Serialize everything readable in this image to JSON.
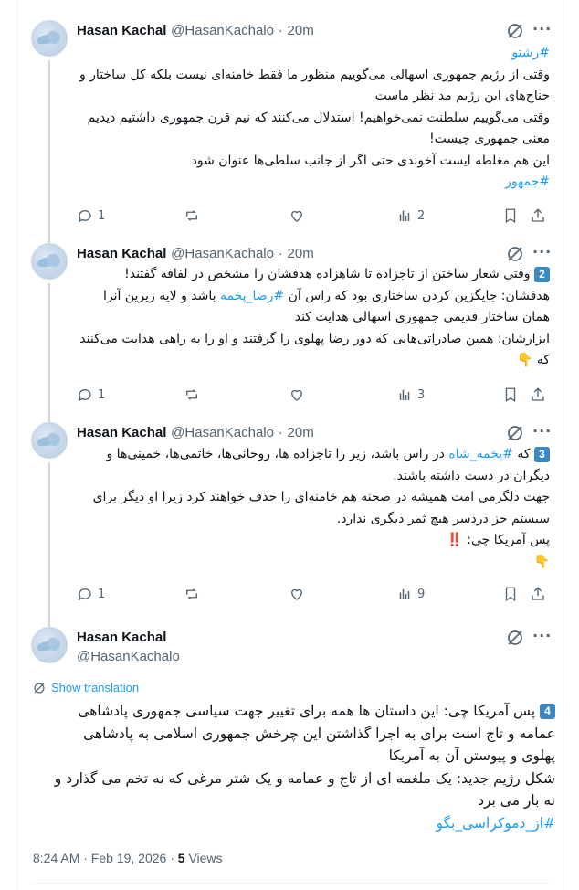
{
  "tweets": [
    {
      "name": "Hasan Kachal",
      "handle": "@HasanKachalo",
      "time": "20m",
      "lines": [
        [
          {
            "t": "#رشتو",
            "tag": true
          }
        ],
        [
          {
            "t": "وقتی از رژیم جمهوری اسهالی می‌گوییم منظور ما فقط خامنه‌ای نیست بلکه کل ساختار و"
          }
        ],
        [
          {
            "t": "جناح‌های این رژیم مد نظر ماست"
          }
        ],
        [
          {
            "t": "وقتی می‌گوییم سلطنت نمی‌خواهیم! استدلال می‌کنند که نیم قرن جمهوری داشتیم دیدیم"
          }
        ],
        [
          {
            "t": "معنی جمهوری چیست!"
          }
        ],
        [
          {
            "t": "این هم مغلطه ایست آخوندی حتی اگر از جانب سلطی‌ها عنوان شود"
          }
        ],
        [
          {
            "t": "#جمهور",
            "tag": true
          }
        ]
      ],
      "replies": "1",
      "reposts": "",
      "likes": "",
      "views": "2"
    },
    {
      "name": "Hasan Kachal",
      "handle": "@HasanKachalo",
      "time": "20m",
      "lines": [
        [
          {
            "t": "2",
            "num": true
          },
          {
            "t": " وقتی شعار ساختن از تاجزاده تا شاهزاده هدفشان را مشخص در لفافه گفتند!"
          }
        ],
        [
          {
            "t": "هدفشان: جایگزین کردن ساختاری بود که راس آن "
          },
          {
            "t": "#رضا_پخمه",
            "tag": true
          },
          {
            "t": " باشد و لایه زیرین آنرا"
          }
        ],
        [
          {
            "t": "همان ساختار قدیمی جمهوری اسهالی هدایت کند"
          }
        ],
        [
          {
            "t": "ابزارشان: همین صادراتی‌هایی که دور رضا پهلوی را گرفتند و او را به راهی هدایت می‌کنند"
          }
        ],
        [
          {
            "t": "که "
          },
          {
            "t": "👇",
            "hand": true
          }
        ]
      ],
      "replies": "1",
      "reposts": "",
      "likes": "",
      "views": "3"
    },
    {
      "name": "Hasan Kachal",
      "handle": "@HasanKachalo",
      "time": "20m",
      "lines": [
        [
          {
            "t": "3",
            "num": true
          },
          {
            "t": " که "
          },
          {
            "t": "#پخمه_شاه",
            "tag": true
          },
          {
            "t": " در راس باشد، زیر را تاجزاده ها، روحانی‌ها، خاتمی‌ها، خمینی‌ها و"
          }
        ],
        [
          {
            "t": "دیگران در دست داشته باشند."
          }
        ],
        [
          {
            "t": "جهت دلگرمی امت همیشه در صحنه هم خامنه‌ای را حذف خواهند کرد زیرا او دیگر برای"
          }
        ],
        [
          {
            "t": "سیستم جز دردسر هیچ ثمر دیگری ندارد."
          }
        ],
        [
          {
            "t": "پس آمریکا چی: "
          },
          {
            "t": "‼️",
            "bang": true
          }
        ],
        [
          {
            "t": "👇",
            "hand": true
          }
        ]
      ],
      "replies": "1",
      "reposts": "",
      "likes": "",
      "views": "9"
    }
  ],
  "main": {
    "name": "Hasan Kachal",
    "handle": "@HasanKachalo",
    "show_translation": "Show translation",
    "lines": [
      [
        {
          "t": "4",
          "num": true
        },
        {
          "t": " پس آمریکا چی: این داستان ها همه برای تغییر جهت سیاسی جمهوری پادشاهی"
        }
      ],
      [
        {
          "t": "عمامه و تاج است برای به اجرا گذاشتن این چرخش جمهوری اسلامی به پادشاهی"
        }
      ],
      [
        {
          "t": "پهلوی و پیوستن آن به آمریکا"
        }
      ],
      [
        {
          "t": "شکل رژیم جدید: یک ملغمه ای از تاج و عمامه و یک شتر مرغی که نه تخم می گذارد و"
        }
      ],
      [
        {
          "t": "نه بار می برد"
        }
      ],
      [
        {
          "t": "#از_دموکراسی_بگو",
          "tag": true
        }
      ]
    ],
    "timestamp": "8:24 AM · Feb 19, 2026 · ",
    "views_count": "5",
    "views_label": " Views"
  },
  "icons": [
    "grok-icon",
    "more-icon",
    "reply-icon",
    "repost-icon",
    "like-icon",
    "views-icon",
    "bookmark-icon",
    "share-icon",
    "translate-icon"
  ],
  "colors": {
    "link": "#1d9bf0",
    "text": "#0f1419",
    "muted": "#536471",
    "thread": "#cfd9de",
    "keycap": "#3b88c3"
  }
}
